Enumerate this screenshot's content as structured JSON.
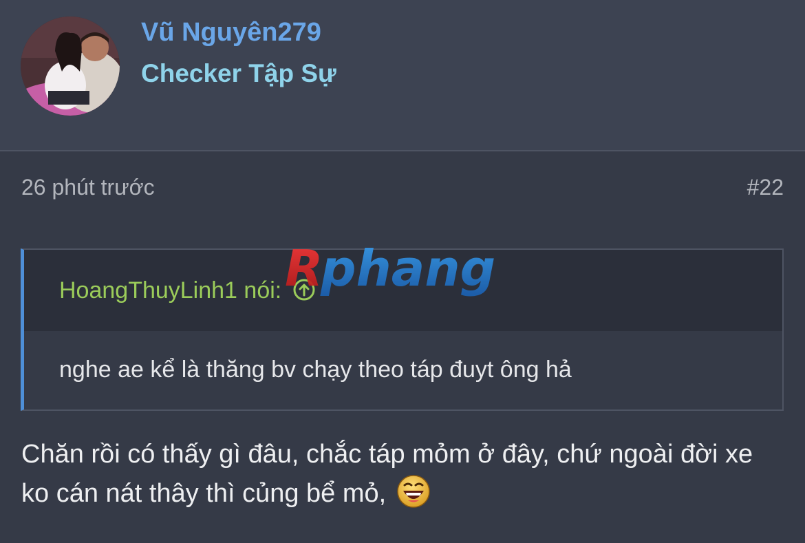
{
  "user": {
    "name": "Vũ Nguyên279",
    "title": "Checker Tập Sự",
    "avatar_icon": "user-photo-avatar"
  },
  "post": {
    "time": "26 phút trước",
    "number": "#22"
  },
  "quote": {
    "author": "HoangThuyLinh1",
    "said": "nói:",
    "jump_icon": "arrow-up-circle-icon",
    "text": "nghe ae kể là thăng bv chạy theo táp đuyt ông hả"
  },
  "message": {
    "text": "Chăn rồi có thấy gì đâu, chắc táp mỏm ở đây, chứ ngoài đời xe ko cán nát thây thì củng bể mỏ,",
    "emoji_icon": "laughing-face-icon"
  },
  "watermark": {
    "text": "Rphang"
  },
  "colors": {
    "background": "#353a47",
    "header_bg": "#3d4352",
    "username": "#6aa6e8",
    "user_title": "#8fd3ea",
    "quote_author": "#9bcc5a",
    "quote_accent": "#4e8fd8"
  }
}
